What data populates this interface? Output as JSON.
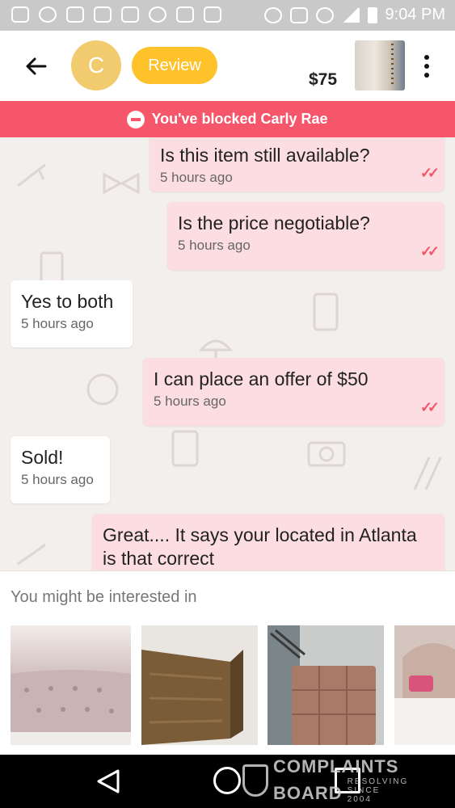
{
  "status_bar": {
    "time": "9:04 PM"
  },
  "header": {
    "avatar_letter": "C",
    "review_label": "Review",
    "price": "$75"
  },
  "banner": {
    "text": "You've blocked Carly Rae"
  },
  "messages": [
    {
      "text": "Is this item still available?",
      "time": "5 hours ago",
      "direction": "out"
    },
    {
      "text": "Is the price negotiable?",
      "time": "5 hours ago",
      "direction": "out"
    },
    {
      "text": "Yes to both",
      "time": "5 hours ago",
      "direction": "in"
    },
    {
      "text": "I can place an offer of $50",
      "time": "5 hours ago",
      "direction": "out"
    },
    {
      "text": "Sold!",
      "time": "5 hours ago",
      "direction": "in"
    },
    {
      "text": "Great.... It says your located in Atlanta is that correct",
      "time": "",
      "direction": "out"
    }
  ],
  "suggestions": {
    "title": "You might be interested in",
    "items": [
      {
        "icon": "tufted-headboard-image"
      },
      {
        "icon": "wood-headboard-image"
      },
      {
        "icon": "leather-headboard-image"
      },
      {
        "icon": "bedroom-image"
      }
    ]
  },
  "watermark": {
    "line1": "COMPLAINTS",
    "line2": "BOARD",
    "line3": "RESOLVING SINCE 2004"
  },
  "colors": {
    "accent": "#f5566a",
    "review": "#ffc22b",
    "avatar": "#f1cb6d",
    "bubble_out": "#fcdde1"
  }
}
